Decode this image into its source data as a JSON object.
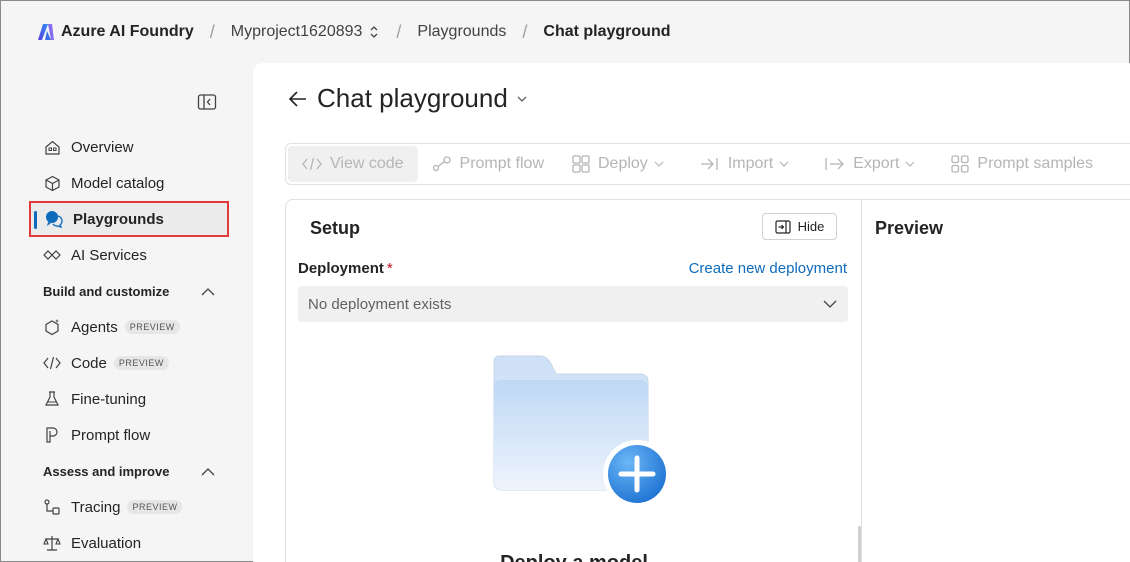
{
  "header": {
    "brand": "Azure AI Foundry",
    "project": "Myproject1620893",
    "crumb_playgrounds": "Playgrounds",
    "crumb_current": "Chat playground"
  },
  "sidebar": {
    "items": [
      {
        "label": "Overview",
        "icon": "home-icon"
      },
      {
        "label": "Model catalog",
        "icon": "cube-icon"
      },
      {
        "label": "Playgrounds",
        "icon": "chat-bubbles-icon",
        "active": true
      },
      {
        "label": "AI Services",
        "icon": "ai-services-icon"
      }
    ],
    "build_section": "Build and customize",
    "build_items": [
      {
        "label": "Agents",
        "badge": "PREVIEW",
        "icon": "agents-icon"
      },
      {
        "label": "Code",
        "badge": "PREVIEW",
        "icon": "code-icon"
      },
      {
        "label": "Fine-tuning",
        "icon": "flask-icon"
      },
      {
        "label": "Prompt flow",
        "icon": "prompt-flow-icon"
      }
    ],
    "assess_section": "Assess and improve",
    "assess_items": [
      {
        "label": "Tracing",
        "badge": "PREVIEW",
        "icon": "tracing-icon"
      },
      {
        "label": "Evaluation",
        "icon": "scales-icon"
      }
    ]
  },
  "main": {
    "title": "Chat playground",
    "toolbar": {
      "view_code": "View code",
      "prompt_flow": "Prompt flow",
      "deploy": "Deploy",
      "import": "Import",
      "export": "Export",
      "prompt_samples": "Prompt samples"
    },
    "setup": {
      "title": "Setup",
      "hide": "Hide",
      "deployment_label": "Deployment",
      "required_mark": "*",
      "create_link": "Create new deployment",
      "select_value": "No deployment exists",
      "empty_title": "Deploy a model"
    },
    "preview": {
      "title": "Preview"
    }
  },
  "colors": {
    "accent": "#0f6cbd",
    "highlight_border": "#e03a3a",
    "required": "#c50f1f"
  }
}
